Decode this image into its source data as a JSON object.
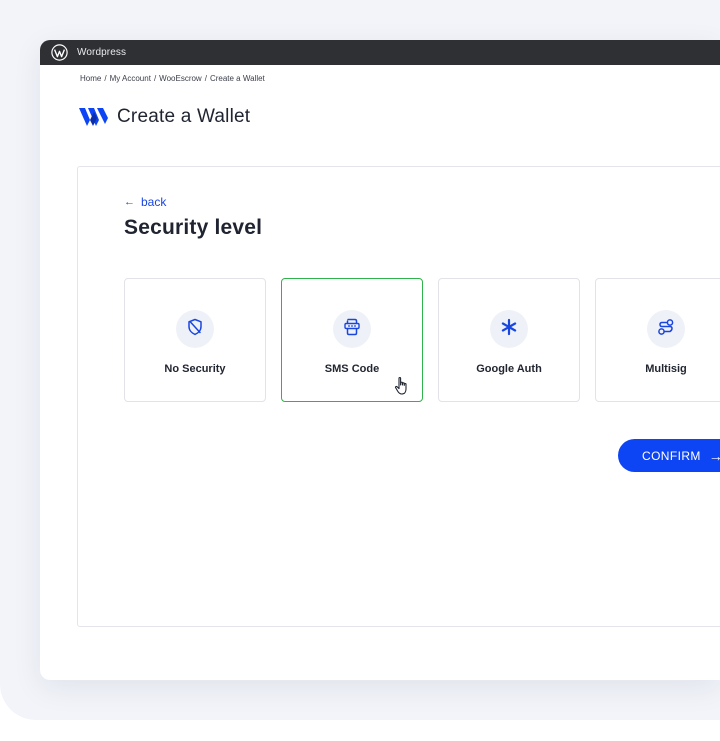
{
  "window": {
    "app_name": "Wordpress"
  },
  "breadcrumb": [
    "Home",
    "My Account",
    "WooEscrow",
    "Create a Wallet"
  ],
  "breadcrumb_separator": "/",
  "brand": {
    "title": "Create a Wallet"
  },
  "panel": {
    "back_label": "back",
    "back_arrow": "←",
    "title": "Security level",
    "options": [
      {
        "label": "No Security",
        "icon": "shield-off-icon"
      },
      {
        "label": "SMS Code",
        "icon": "sms-code-icon",
        "selected": true
      },
      {
        "label": "Google Auth",
        "icon": "asterisk-icon"
      },
      {
        "label": "Multisig",
        "icon": "multisig-icon"
      }
    ],
    "confirm_label": "CONFIRM",
    "confirm_arrow": "→"
  },
  "colors": {
    "accent": "#0d45f5",
    "selected_border": "#2fb34a",
    "titlebar": "#2f3033",
    "icon_bg": "#eef1f7"
  }
}
